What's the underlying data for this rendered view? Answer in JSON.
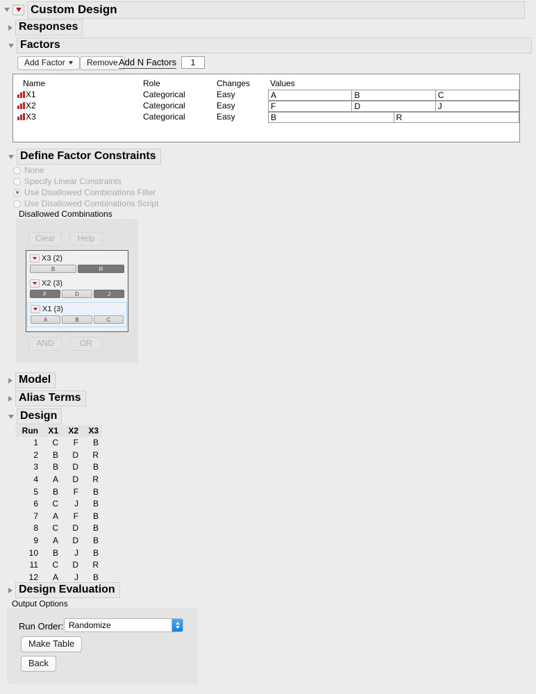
{
  "window": {
    "title": "Custom Design"
  },
  "sections": {
    "responses": {
      "label": "Responses",
      "expanded": false
    },
    "factors": {
      "label": "Factors",
      "expanded": true
    },
    "constraints": {
      "label": "Define Factor Constraints",
      "expanded": true
    },
    "model": {
      "label": "Model",
      "expanded": false
    },
    "alias_terms": {
      "label": "Alias Terms",
      "expanded": false
    },
    "design": {
      "label": "Design",
      "expanded": true
    },
    "design_evaluation": {
      "label": "Design Evaluation",
      "expanded": false
    }
  },
  "factors_toolbar": {
    "add_factor": "Add Factor",
    "remove": "Remove",
    "add_n_factors": "Add N Factors",
    "n_value": "1"
  },
  "factors_table": {
    "headers": [
      "Name",
      "Role",
      "Changes",
      "Values"
    ],
    "rows": [
      {
        "name": "X1",
        "role": "Categorical",
        "changes": "Easy",
        "values": [
          "A",
          "B",
          "C"
        ]
      },
      {
        "name": "X2",
        "role": "Categorical",
        "changes": "Easy",
        "values": [
          "F",
          "D",
          "J"
        ]
      },
      {
        "name": "X3",
        "role": "Categorical",
        "changes": "Easy",
        "values": [
          "B",
          "R"
        ]
      }
    ]
  },
  "constraints": {
    "options": [
      {
        "label": "None",
        "selected": false,
        "enabled": false
      },
      {
        "label": "Specify Linear Constraints",
        "selected": false,
        "enabled": false
      },
      {
        "label": "Use Disallowed Combinations Filter",
        "selected": true,
        "enabled": false
      },
      {
        "label": "Use Disallowed Combinations Script",
        "selected": false,
        "enabled": false
      }
    ],
    "panel_title": "Disallowed Combinations",
    "buttons": {
      "clear": "Clear",
      "help": "Help",
      "and": "AND",
      "or": "OR"
    },
    "filter_groups": [
      {
        "title": "X3 (2)",
        "selected": false,
        "levels": [
          {
            "label": "B",
            "active": false
          },
          {
            "label": "R",
            "active": true
          }
        ]
      },
      {
        "title": "X2 (3)",
        "selected": false,
        "levels": [
          {
            "label": "F",
            "active": true
          },
          {
            "label": "D",
            "active": false
          },
          {
            "label": "J",
            "active": true
          }
        ]
      },
      {
        "title": "X1 (3)",
        "selected": true,
        "levels": [
          {
            "label": "A",
            "active": false
          },
          {
            "label": "B",
            "active": false
          },
          {
            "label": "C",
            "active": false
          }
        ]
      }
    ]
  },
  "design_table": {
    "headers": [
      "Run",
      "X1",
      "X2",
      "X3"
    ],
    "rows": [
      [
        "1",
        "C",
        "F",
        "B"
      ],
      [
        "2",
        "B",
        "D",
        "R"
      ],
      [
        "3",
        "B",
        "D",
        "B"
      ],
      [
        "4",
        "A",
        "D",
        "R"
      ],
      [
        "5",
        "B",
        "F",
        "B"
      ],
      [
        "6",
        "C",
        "J",
        "B"
      ],
      [
        "7",
        "A",
        "F",
        "B"
      ],
      [
        "8",
        "C",
        "D",
        "B"
      ],
      [
        "9",
        "A",
        "D",
        "B"
      ],
      [
        "10",
        "B",
        "J",
        "B"
      ],
      [
        "11",
        "C",
        "D",
        "R"
      ],
      [
        "12",
        "A",
        "J",
        "B"
      ]
    ]
  },
  "output_options": {
    "title": "Output Options",
    "run_order_label": "Run Order:",
    "run_order_value": "Randomize",
    "make_table": "Make Table",
    "back": "Back"
  },
  "colors": {
    "background": "#ececec",
    "accent_red": "#c0121a",
    "selected_bar": "#787878",
    "stepper_blue": "#1a7fe0",
    "group_highlight": "#eaf3fb"
  }
}
